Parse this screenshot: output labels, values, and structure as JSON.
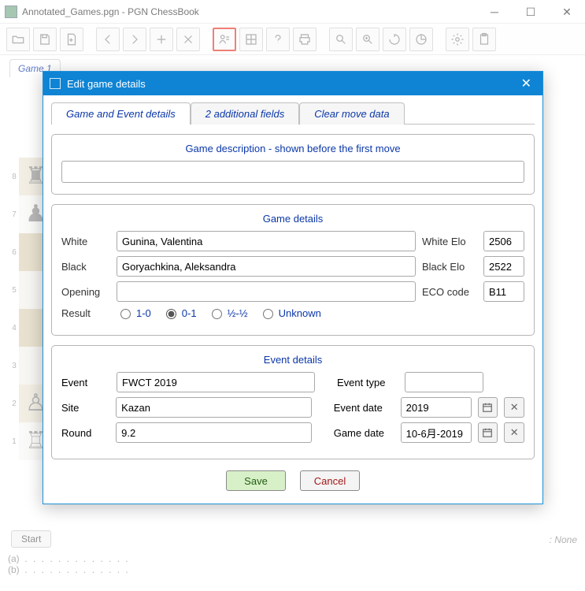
{
  "window": {
    "title": "Annotated_Games.pgn - PGN ChessBook"
  },
  "doc_tab": "Game 1",
  "modal": {
    "title": "Edit game details",
    "tabs": {
      "t1": "Game and Event details",
      "t2": "2 additional fields",
      "t3": "Clear move data"
    },
    "desc_section_title": "Game description - shown before the first move",
    "game_details": {
      "title": "Game details",
      "labels": {
        "white": "White",
        "black": "Black",
        "opening": "Opening",
        "result": "Result",
        "white_elo": "White Elo",
        "black_elo": "Black Elo",
        "eco": "ECO code"
      },
      "values": {
        "white": "Gunina, Valentina",
        "black": "Goryachkina, Aleksandra",
        "opening": "",
        "white_elo": "2506",
        "black_elo": "2522",
        "eco": "B11"
      },
      "results": {
        "r1": "1-0",
        "r2": "0-1",
        "r3": "½-½",
        "r4": "Unknown"
      },
      "selected_result": "0-1"
    },
    "event_details": {
      "title": "Event details",
      "labels": {
        "event": "Event",
        "site": "Site",
        "round": "Round",
        "event_type": "Event type",
        "event_date": "Event date",
        "game_date": "Game date"
      },
      "values": {
        "event": "FWCT 2019",
        "site": "Kazan",
        "round": "9.2",
        "event_type": "",
        "event_date": "2019",
        "game_date": "10-6月-2019"
      }
    },
    "buttons": {
      "save": "Save",
      "cancel": "Cancel"
    }
  },
  "footer": {
    "start": "Start",
    "open_none": ": None",
    "line_a": "(a)",
    "line_b": "(b)",
    "dots": ". . . . . . . . . . . . ."
  }
}
